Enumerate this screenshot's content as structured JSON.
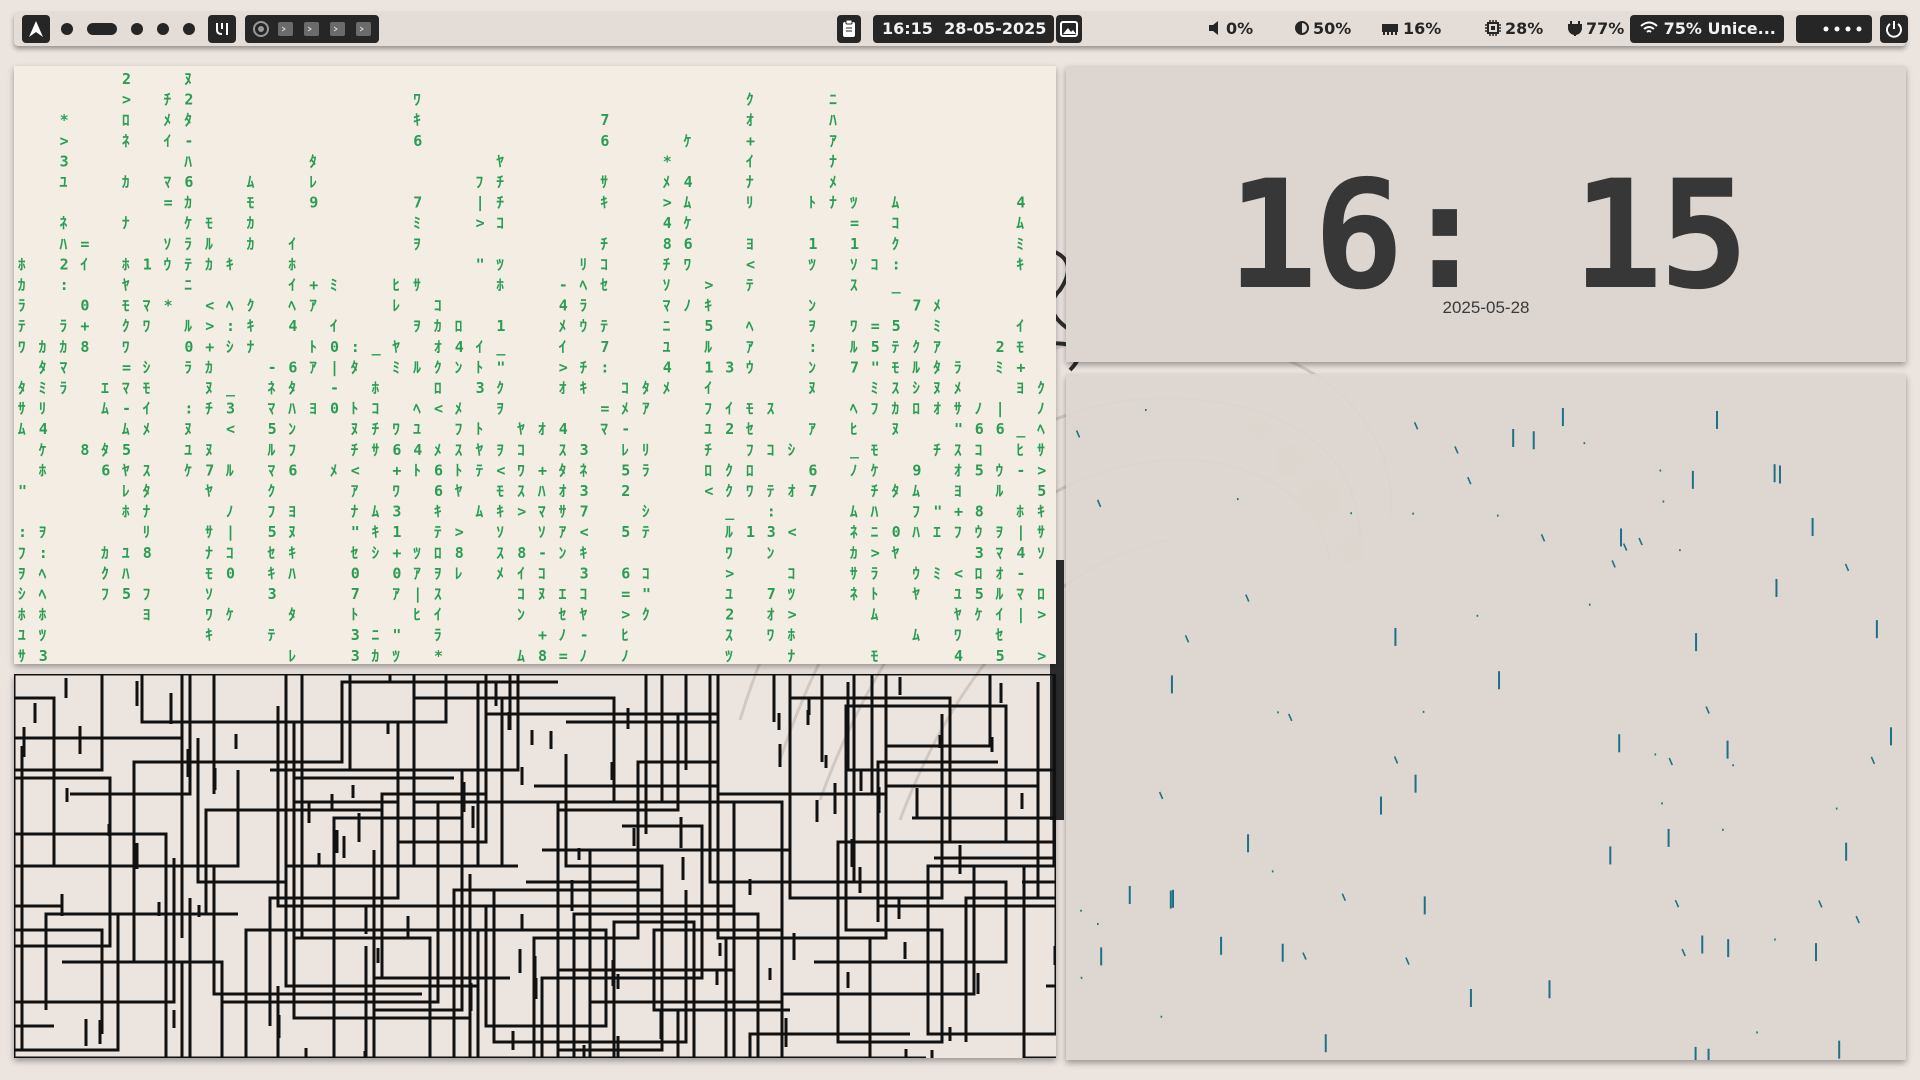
{
  "topbar": {
    "time": "16:15",
    "date": "28-05-2025",
    "volume": "0%",
    "brightness": "50%",
    "memory": "16%",
    "cpu": "28%",
    "battery": "77%",
    "wifi": "75% Unice...",
    "accent": "#262626"
  },
  "clock_widget": {
    "time": "16: 15",
    "date": "2025-05-28"
  },
  "colors": {
    "matrix_glyph": "#2a9d55",
    "rain_drop": "#1f6f86",
    "pipes": "#111111"
  }
}
